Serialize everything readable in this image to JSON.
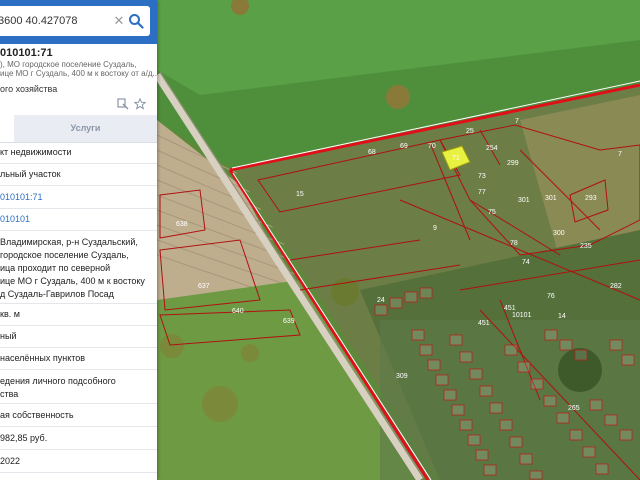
{
  "search": {
    "value": "3600 40.427078",
    "clear_icon": "close-icon",
    "search_icon": "search-icon"
  },
  "object": {
    "title": "010101:71",
    "address_line1": "), МО городское поселение Суздаль,",
    "address_line2": "ице МО г Суздаль, 400 м к востоку от а/д...",
    "use_short": "ого хозяйства"
  },
  "tabs": {
    "services_label": "Услуги"
  },
  "details": {
    "type": "кт недвижимости",
    "kind": "льный участок",
    "cad_number": "010101:71",
    "quarter": "010101",
    "address_1": "Владимирская, р-н Суздальский,",
    "address_2": "городское поселение Суздаль,",
    "address_3": "ица проходит по северной",
    "address_4": "ице МО г Суздаль, 400 м к востоку",
    "address_5": "д Суздаль-Гаврилов Посад",
    "area": "кв. м",
    "status": "ный",
    "category": "населённых пунктов",
    "permitted_use_1": "едения личного подсобного",
    "permitted_use_2": "ства",
    "ownership": "ая собственность",
    "cost": "982,85 руб.",
    "date": "2022"
  },
  "map_labels": {
    "p25": "25",
    "p7a": "7",
    "p7b": "7",
    "p68": "68",
    "p69": "69",
    "p70": "70",
    "p71": "71",
    "p254": "254",
    "p299": "299",
    "p73": "73",
    "p77": "77",
    "p75": "75",
    "p15": "15",
    "p9": "9",
    "p301a": "301",
    "p301b": "301",
    "p300": "300",
    "p293": "293",
    "p78": "78",
    "p235": "235",
    "p74": "74",
    "p76": "76",
    "p24": "24",
    "p451a": "451",
    "p451b": "451",
    "p10101": "10101",
    "p14": "14",
    "p638": "638",
    "p637": "637",
    "p640": "640",
    "p639": "639",
    "p309": "309",
    "p265": "265",
    "p282": "282"
  },
  "colors": {
    "accent": "#2b6ec4",
    "boundary": "#e0101a",
    "plot_line": "#b01010",
    "selected": "#e8f040"
  }
}
